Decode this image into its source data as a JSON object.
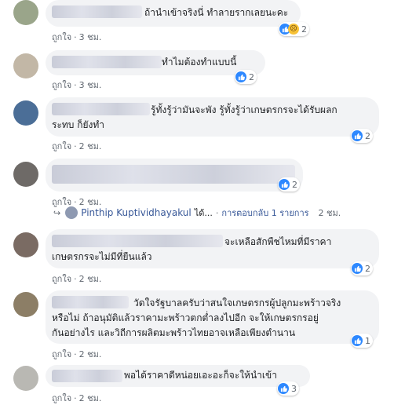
{
  "comments": [
    {
      "text_lines": [
        "ถ้านำเข้าจริงนี่ ทำลายรากเลยนะคะ"
      ],
      "like_label": "ถูกใจ",
      "time": "3 ชม.",
      "reaction_count": "2",
      "reactions": [
        "like",
        "sad"
      ]
    },
    {
      "text_lines": [
        "ทำไมต้องทำแบบนี้"
      ],
      "like_label": "ถูกใจ",
      "time": "3 ชม.",
      "reaction_count": "2",
      "reactions": [
        "like"
      ]
    },
    {
      "text_lines": [
        "รู้ทั้งรู้ว่ามันจะพัง รู้ทั้งรู้ว่าเกษตรกรจะได้รับผลก",
        "ระทบ ก็ยังทำ"
      ],
      "like_label": "ถูกใจ",
      "time": "2 ชม.",
      "reaction_count": "2",
      "reactions": [
        "like"
      ]
    },
    {
      "text_lines": [],
      "like_label": "ถูกใจ",
      "time": "2 ชม.",
      "reaction_count": "2",
      "reactions": [
        "like"
      ],
      "reply": {
        "name": "Pinthip Kuptividhayakul",
        "suffix": "ได้...",
        "action": "การตอบกลับ 1 รายการ",
        "time": "2 ชม."
      }
    },
    {
      "text_lines": [
        "จะเหลือสักพืชไหมที่มีราคา",
        "เกษตรกรจะไม่มีที่ยืนแล้ว"
      ],
      "like_label": "ถูกใจ",
      "time": "2 ชม.",
      "reaction_count": "2",
      "reactions": [
        "like"
      ]
    },
    {
      "text_lines": [
        "วัดใจรัฐบาลครับว่าสนใจเกษตรกรผู้ปลูกมะพร้าวจริง",
        "หรือไม่ ถ้าอนุมัติแล้วราคามะพร้าวตกต่ำลงไปอีก จะให้เกษตรกรอยู่",
        "กันอย่างไร และวิถีการผลิตมะพร้าวไทยอาจเหลือเพียงตำนาน"
      ],
      "like_label": "ถูกใจ",
      "time": "2 ชม.",
      "reaction_count": "1",
      "reactions": [
        "like"
      ]
    },
    {
      "text_lines": [
        "พอได้ราคาดีหน่อยเอะอะก็จะให้นำเข้า"
      ],
      "like_label": "ถูกใจ",
      "time": "2 ชม.",
      "reaction_count": "3",
      "reactions": [
        "like"
      ]
    }
  ],
  "colors": {
    "link": "#385898",
    "like": "#2d88ff",
    "bubble": "#f2f3f5",
    "meta": "#606770"
  }
}
